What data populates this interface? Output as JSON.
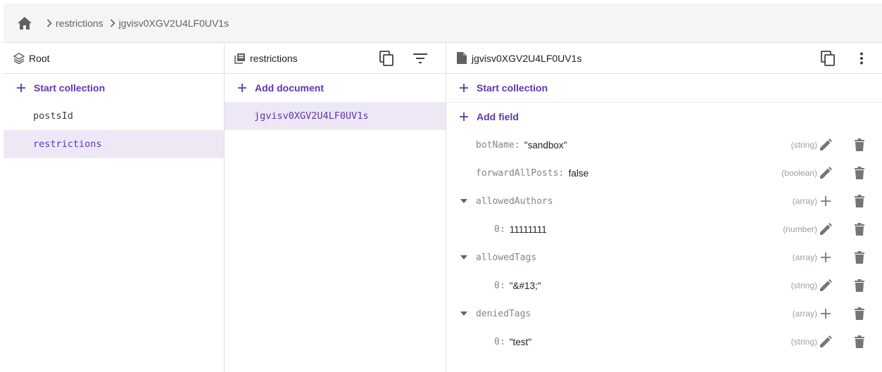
{
  "breadcrumb": {
    "items": [
      "restrictions",
      "jgvisv0XGV2U4LF0UV1s"
    ]
  },
  "panels": {
    "root": {
      "title": "Root",
      "add_label": "Start collection",
      "items": [
        "postsId",
        "restrictions"
      ],
      "selected": "restrictions"
    },
    "collection": {
      "title": "restrictions",
      "add_label": "Add document",
      "items": [
        "jgvisv0XGV2U4LF0UV1s"
      ],
      "selected": "jgvisv0XGV2U4LF0UV1s"
    },
    "document": {
      "title": "jgvisv0XGV2U4LF0UV1s",
      "start_collection_label": "Start collection",
      "add_field_label": "Add field",
      "fields": [
        {
          "key": "botName:",
          "value": "\"sandbox\"",
          "type": "(string)"
        },
        {
          "key": "forwardAllPosts:",
          "value": "false",
          "type": "(boolean)"
        },
        {
          "key": "allowedAuthors",
          "value": "",
          "type": "(array)"
        },
        {
          "key": "0:",
          "value": "11111111",
          "type": "(number)"
        },
        {
          "key": "allowedTags",
          "value": "",
          "type": "(array)"
        },
        {
          "key": "0:",
          "value": "\"&#13;\"",
          "type": "(string)"
        },
        {
          "key": "deniedTags",
          "value": "",
          "type": "(array)"
        },
        {
          "key": "0:",
          "value": "\"test\"",
          "type": "(string)"
        }
      ]
    }
  },
  "colors": {
    "accent": "#5e35b1",
    "selected_bg": "#ede7f6",
    "icon_gray": "#757575"
  },
  "icons": {
    "home": "home-icon",
    "root": "layers-icon",
    "collection": "collection-icon",
    "document": "document-icon",
    "copy": "copy-icon",
    "filter": "filter-icon",
    "more": "more-vert-icon",
    "edit": "pencil-icon",
    "delete": "trash-icon",
    "add": "plus-icon",
    "expand": "caret-down-icon"
  }
}
